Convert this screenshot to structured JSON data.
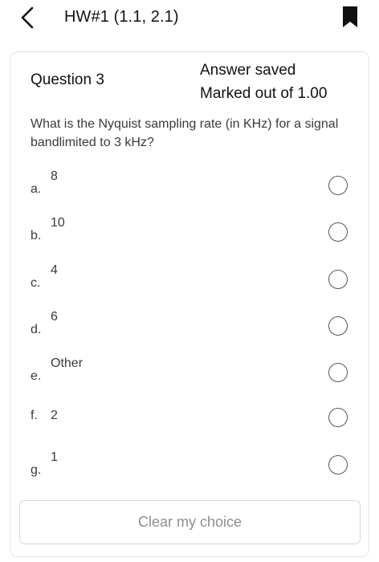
{
  "header": {
    "title": "HW#1 (1.1, 2.1)",
    "back_icon": "chevron-left-icon",
    "bookmark_icon": "bookmark-icon"
  },
  "question": {
    "number_label": "Question 3",
    "status": "Answer saved",
    "marks": "Marked out of 1.00",
    "text": "What is the Nyquist sampling rate (in KHz) for a signal bandlimited to 3 kHz?"
  },
  "options": [
    {
      "letter": "a.",
      "text": "8"
    },
    {
      "letter": "b.",
      "text": "10"
    },
    {
      "letter": "c.",
      "text": "4"
    },
    {
      "letter": "d.",
      "text": "6"
    },
    {
      "letter": "e.",
      "text": "Other"
    },
    {
      "letter": "f.",
      "text": "2"
    },
    {
      "letter": "g.",
      "text": "1"
    }
  ],
  "actions": {
    "clear_label": "Clear my choice"
  }
}
